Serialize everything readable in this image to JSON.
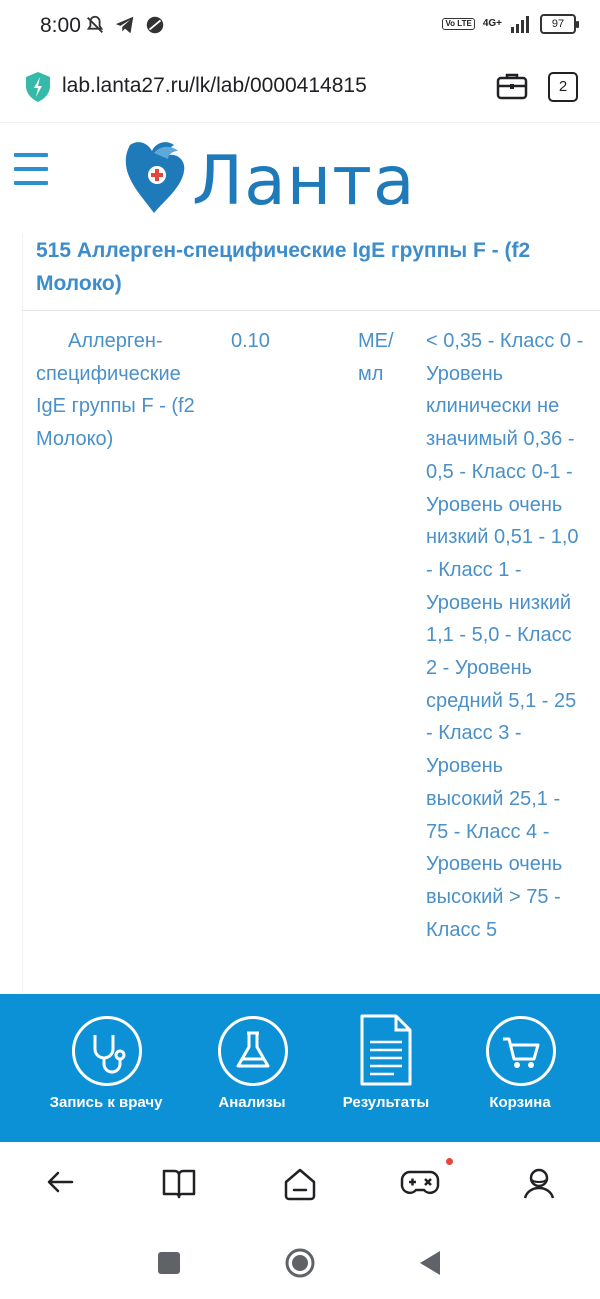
{
  "status": {
    "time": "8:00",
    "volte": "Vo LTE",
    "network": "4G+",
    "battery": "97"
  },
  "browser": {
    "url": "lab.lanta27.ru/lk/lab/0000414815",
    "tab_count": "2"
  },
  "site": {
    "logo_text": "Ланта"
  },
  "result": {
    "title": "515 Аллерген-специфические IgE группы F - (f2 Молоко)",
    "name": "Аллерген-специфические IgE группы F - (f2 Молоко)",
    "value": "0.10",
    "unit": "МЕ/мл",
    "reference": "< 0,35 - Класс 0 - Уровень клинически не значимый 0,36 - 0,5 - Класс 0-1 - Уровень очень низкий 0,51 - 1,0 - Класс 1 - Уровень низкий 1,1 - 5,0 - Класс 2 - Уровень средний 5,1 - 25 - Класс 3 - Уровень высокий 25,1 - 75 - Класс 4 - Уровень очень высокий > 75 - Класс 5"
  },
  "bottom_nav": {
    "items": [
      {
        "label": "Запись к врачу",
        "icon": "stethoscope-icon"
      },
      {
        "label": "Анализы",
        "icon": "flask-icon"
      },
      {
        "label": "Результаты",
        "icon": "document-icon"
      },
      {
        "label": "Корзина",
        "icon": "cart-icon"
      }
    ]
  },
  "colors": {
    "accent": "#0d91d6",
    "text_blue": "#4a90c9",
    "logo_blue": "#1e7ab8"
  }
}
